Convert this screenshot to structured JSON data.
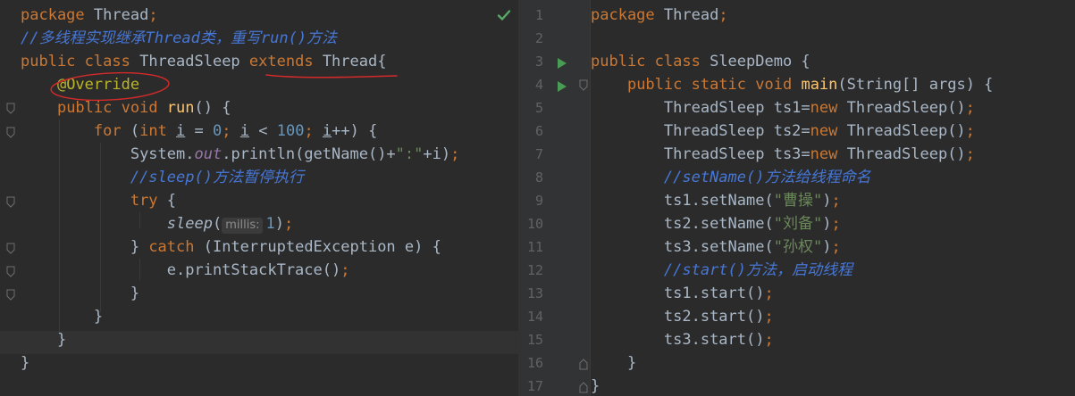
{
  "left_editor": {
    "lines": [
      {
        "segments": [
          {
            "t": "package ",
            "c": "k"
          },
          {
            "t": "Thread",
            "c": "cls"
          },
          {
            "t": ";",
            "c": "k"
          }
        ]
      },
      {
        "segments": [
          {
            "t": "//多线程实现继承Thread类，重写run()方法",
            "c": "cmt-blue"
          }
        ]
      },
      {
        "segments": [
          {
            "t": "public ",
            "c": "k"
          },
          {
            "t": "class ",
            "c": "k"
          },
          {
            "t": "ThreadSleep ",
            "c": "cls"
          },
          {
            "t": "extends",
            "c": "k"
          },
          {
            "t": " ",
            "c": "cls"
          },
          {
            "t": "Thread",
            "c": "cls"
          },
          {
            "t": "{",
            "c": "cls"
          }
        ]
      },
      {
        "segments": [
          {
            "t": "    ",
            "c": "cls"
          },
          {
            "t": "@Override",
            "c": "ann"
          }
        ]
      },
      {
        "segments": [
          {
            "t": "    ",
            "c": "cls"
          },
          {
            "t": "public ",
            "c": "k"
          },
          {
            "t": "void ",
            "c": "k"
          },
          {
            "t": "run",
            "c": "fn"
          },
          {
            "t": "() {",
            "c": "cls"
          }
        ]
      },
      {
        "segments": [
          {
            "t": "        ",
            "c": "cls"
          },
          {
            "t": "for ",
            "c": "k"
          },
          {
            "t": "(",
            "c": "cls"
          },
          {
            "t": "int ",
            "c": "k"
          },
          {
            "t": "i",
            "c": "uline"
          },
          {
            "t": " = ",
            "c": "cls"
          },
          {
            "t": "0",
            "c": "num"
          },
          {
            "t": "; ",
            "c": "k"
          },
          {
            "t": "i",
            "c": "uline"
          },
          {
            "t": " < ",
            "c": "cls"
          },
          {
            "t": "100",
            "c": "num"
          },
          {
            "t": "; ",
            "c": "k"
          },
          {
            "t": "i",
            "c": "uline"
          },
          {
            "t": "++) {",
            "c": "cls"
          }
        ]
      },
      {
        "segments": [
          {
            "t": "            ",
            "c": "cls"
          },
          {
            "t": "System.",
            "c": "cls"
          },
          {
            "t": "out",
            "c": "fld"
          },
          {
            "t": ".println(getName()+",
            "c": "cls"
          },
          {
            "t": "\":\"",
            "c": "str"
          },
          {
            "t": "+i)",
            "c": "cls"
          },
          {
            "t": ";",
            "c": "k"
          }
        ]
      },
      {
        "segments": [
          {
            "t": "            ",
            "c": "cls"
          },
          {
            "t": "//sleep()方法暂停执行",
            "c": "cmt-blue"
          }
        ]
      },
      {
        "segments": [
          {
            "t": "            ",
            "c": "cls"
          },
          {
            "t": "try ",
            "c": "k"
          },
          {
            "t": "{",
            "c": "cls"
          }
        ]
      },
      {
        "segments": [
          {
            "t": "                ",
            "c": "cls"
          },
          {
            "t": "sleep",
            "c": "static-call"
          },
          {
            "t": "(",
            "c": "cls"
          },
          {
            "hint": "millis:"
          },
          {
            "t": "1",
            "c": "num"
          },
          {
            "t": ")",
            "c": "cls"
          },
          {
            "t": ";",
            "c": "k"
          }
        ]
      },
      {
        "segments": [
          {
            "t": "            ",
            "c": "cls"
          },
          {
            "t": "} ",
            "c": "cls"
          },
          {
            "t": "catch ",
            "c": "k"
          },
          {
            "t": "(InterruptedException e) {",
            "c": "cls"
          }
        ]
      },
      {
        "segments": [
          {
            "t": "                ",
            "c": "cls"
          },
          {
            "t": "e.printStackTrace()",
            "c": "cls"
          },
          {
            "t": ";",
            "c": "k"
          }
        ]
      },
      {
        "segments": [
          {
            "t": "            ",
            "c": "cls"
          },
          {
            "t": "}",
            "c": "cls"
          }
        ]
      },
      {
        "segments": [
          {
            "t": "        ",
            "c": "cls"
          },
          {
            "t": "}",
            "c": "cls"
          }
        ]
      },
      {
        "segments": [
          {
            "t": "    ",
            "c": "cls"
          },
          {
            "t": "}",
            "c": "cls"
          }
        ]
      },
      {
        "segments": [
          {
            "t": "}",
            "c": "cls"
          }
        ]
      }
    ]
  },
  "right_editor": {
    "line_numbers": [
      "1",
      "2",
      "3",
      "4",
      "5",
      "6",
      "7",
      "8",
      "9",
      "10",
      "11",
      "12",
      "13",
      "14",
      "15",
      "16",
      "17"
    ],
    "lines": [
      {
        "segments": [
          {
            "t": "package ",
            "c": "k"
          },
          {
            "t": "Thread",
            "c": "cls"
          },
          {
            "t": ";",
            "c": "k"
          }
        ]
      },
      {
        "segments": []
      },
      {
        "segments": [
          {
            "t": "public ",
            "c": "k"
          },
          {
            "t": "class ",
            "c": "k"
          },
          {
            "t": "SleepDemo {",
            "c": "cls"
          }
        ]
      },
      {
        "segments": [
          {
            "t": "    ",
            "c": "cls"
          },
          {
            "t": "public ",
            "c": "k"
          },
          {
            "t": "static ",
            "c": "k"
          },
          {
            "t": "void ",
            "c": "k"
          },
          {
            "t": "main",
            "c": "fn"
          },
          {
            "t": "(String[] args) {",
            "c": "cls"
          }
        ]
      },
      {
        "segments": [
          {
            "t": "        ",
            "c": "cls"
          },
          {
            "t": "ThreadSleep ts1=",
            "c": "cls"
          },
          {
            "t": "new ",
            "c": "k"
          },
          {
            "t": "ThreadSleep()",
            "c": "cls"
          },
          {
            "t": ";",
            "c": "k"
          }
        ]
      },
      {
        "segments": [
          {
            "t": "        ",
            "c": "cls"
          },
          {
            "t": "ThreadSleep ts2=",
            "c": "cls"
          },
          {
            "t": "new ",
            "c": "k"
          },
          {
            "t": "ThreadSleep()",
            "c": "cls"
          },
          {
            "t": ";",
            "c": "k"
          }
        ]
      },
      {
        "segments": [
          {
            "t": "        ",
            "c": "cls"
          },
          {
            "t": "ThreadSleep ts3=",
            "c": "cls"
          },
          {
            "t": "new ",
            "c": "k"
          },
          {
            "t": "ThreadSleep()",
            "c": "cls"
          },
          {
            "t": ";",
            "c": "k"
          }
        ]
      },
      {
        "segments": [
          {
            "t": "        ",
            "c": "cls"
          },
          {
            "t": "//setName()方法给线程命名",
            "c": "cmt-blue"
          }
        ]
      },
      {
        "segments": [
          {
            "t": "        ",
            "c": "cls"
          },
          {
            "t": "ts1.setName(",
            "c": "cls"
          },
          {
            "t": "\"曹操\"",
            "c": "str"
          },
          {
            "t": ")",
            "c": "cls"
          },
          {
            "t": ";",
            "c": "k"
          }
        ]
      },
      {
        "segments": [
          {
            "t": "        ",
            "c": "cls"
          },
          {
            "t": "ts2.setName(",
            "c": "cls"
          },
          {
            "t": "\"刘备\"",
            "c": "str"
          },
          {
            "t": ")",
            "c": "cls"
          },
          {
            "t": ";",
            "c": "k"
          }
        ]
      },
      {
        "segments": [
          {
            "t": "        ",
            "c": "cls"
          },
          {
            "t": "ts3.setName(",
            "c": "cls"
          },
          {
            "t": "\"孙权\"",
            "c": "str"
          },
          {
            "t": ")",
            "c": "cls"
          },
          {
            "t": ";",
            "c": "k"
          }
        ]
      },
      {
        "segments": [
          {
            "t": "        ",
            "c": "cls"
          },
          {
            "t": "//start()方法，启动线程",
            "c": "cmt-blue"
          }
        ]
      },
      {
        "segments": [
          {
            "t": "        ",
            "c": "cls"
          },
          {
            "t": "ts1.start()",
            "c": "cls"
          },
          {
            "t": ";",
            "c": "k"
          }
        ]
      },
      {
        "segments": [
          {
            "t": "        ",
            "c": "cls"
          },
          {
            "t": "ts2.start()",
            "c": "cls"
          },
          {
            "t": ";",
            "c": "k"
          }
        ]
      },
      {
        "segments": [
          {
            "t": "        ",
            "c": "cls"
          },
          {
            "t": "ts3.start()",
            "c": "cls"
          },
          {
            "t": ";",
            "c": "k"
          }
        ]
      },
      {
        "segments": [
          {
            "t": "    ",
            "c": "cls"
          },
          {
            "t": "}",
            "c": "cls"
          }
        ]
      },
      {
        "segments": [
          {
            "t": "}",
            "c": "cls"
          }
        ]
      }
    ]
  },
  "colors": {
    "background": "#2b2b2b",
    "gutter": "#313335",
    "keyword": "#cc7832",
    "annotation": "#bbb529",
    "number": "#6897bb",
    "string": "#6a8759",
    "comment": "#4777d6",
    "method": "#ffc66d",
    "ink_annotation": "#d42a2a",
    "inspection_ok": "#59a869",
    "run_gutter": "#499c54"
  },
  "icons": {
    "inspection": "check-icon",
    "run": "run-arrow-icon",
    "fold": "fold-marker-icon"
  }
}
